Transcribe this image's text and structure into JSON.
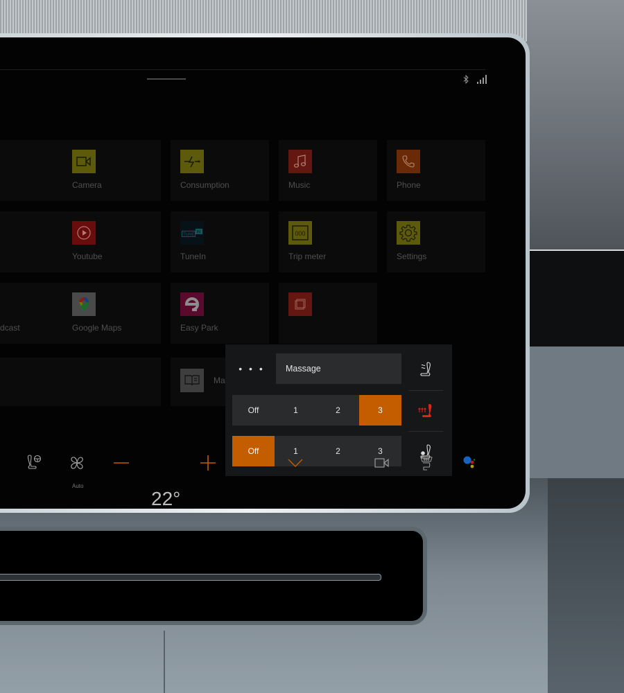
{
  "status_bar": {
    "bluetooth_icon": "bluetooth-icon",
    "signal_icon": "signal-bars-icon"
  },
  "apps": [
    {
      "label": "Camera",
      "icon": "video-camera-icon",
      "color": "#5d5a0b"
    },
    {
      "label": "Consumption",
      "icon": "lightning-icon",
      "color": "#5d5a0b"
    },
    {
      "label": "Music",
      "icon": "music-note-icon",
      "color": "#641610"
    },
    {
      "label": "Phone",
      "icon": "phone-icon",
      "color": "#6a2a07"
    },
    {
      "label": "Youtube",
      "icon": "play-icon",
      "color": "#680c0c"
    },
    {
      "label": "TuneIn",
      "icon": "tunein-icon",
      "color": "#061218"
    },
    {
      "label": "Trip meter",
      "icon": "odometer-icon",
      "color": "#5d5a0b"
    },
    {
      "label": "Settings",
      "icon": "gear-icon",
      "color": "#5d5a0b"
    },
    {
      "label": "dcast",
      "icon": "",
      "color": ""
    },
    {
      "label": "Google Maps",
      "icon": "map-pin-icon",
      "color": "#4a4a4a"
    },
    {
      "label": "Easy Park",
      "icon": "easypark-icon",
      "color": "#5a0a2c"
    },
    {
      "label": "Ma",
      "icon": "manual-book-icon",
      "color": "#3e3e3e"
    }
  ],
  "seat_popup": {
    "more_label": "• • •",
    "mode_label": "Massage",
    "heating": {
      "options": [
        "Off",
        "1",
        "2",
        "3"
      ],
      "selected": "3"
    },
    "ventilation": {
      "options": [
        "Off",
        "1",
        "2",
        "3"
      ],
      "selected": "Off"
    },
    "icons": [
      "seat-massage-icon",
      "seat-heating-icon",
      "seat-ventilation-icon"
    ],
    "accent": "#c45c00",
    "heat_color": "#e0241a"
  },
  "climate_bar": {
    "fan_mode": "Auto",
    "temperature": "22°",
    "accent": "#c45c00"
  }
}
